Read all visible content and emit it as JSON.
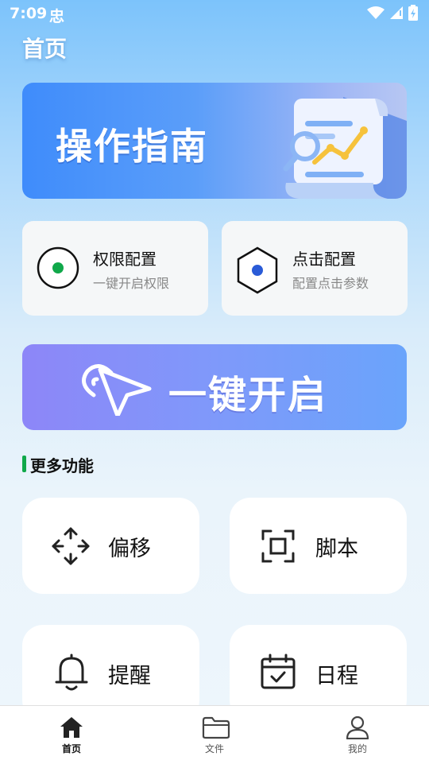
{
  "status_bar": {
    "time": "7:09",
    "carrier_glyph": "忠"
  },
  "header": {
    "title": "首页"
  },
  "guide_banner": {
    "title": "操作指南"
  },
  "config_cards": [
    {
      "title": "权限配置",
      "subtitle": "一键开启权限",
      "icon": "radio-target-icon",
      "accent": "#10a84a"
    },
    {
      "title": "点击配置",
      "subtitle": "配置点击参数",
      "icon": "hexagon-dot-icon",
      "accent": "#2a5bd7"
    }
  ],
  "one_key": {
    "label": "一键开启"
  },
  "section": {
    "title": "更多功能"
  },
  "functions": [
    {
      "label": "偏移",
      "icon": "move-arrows-icon"
    },
    {
      "label": "脚本",
      "icon": "scan-frame-icon"
    },
    {
      "label": "提醒",
      "icon": "bell-icon"
    },
    {
      "label": "日程",
      "icon": "calendar-check-icon"
    }
  ],
  "bottom_nav": [
    {
      "label": "首页",
      "icon": "home-icon",
      "active": true
    },
    {
      "label": "文件",
      "icon": "folder-icon",
      "active": false
    },
    {
      "label": "我的",
      "icon": "user-icon",
      "active": false
    }
  ]
}
